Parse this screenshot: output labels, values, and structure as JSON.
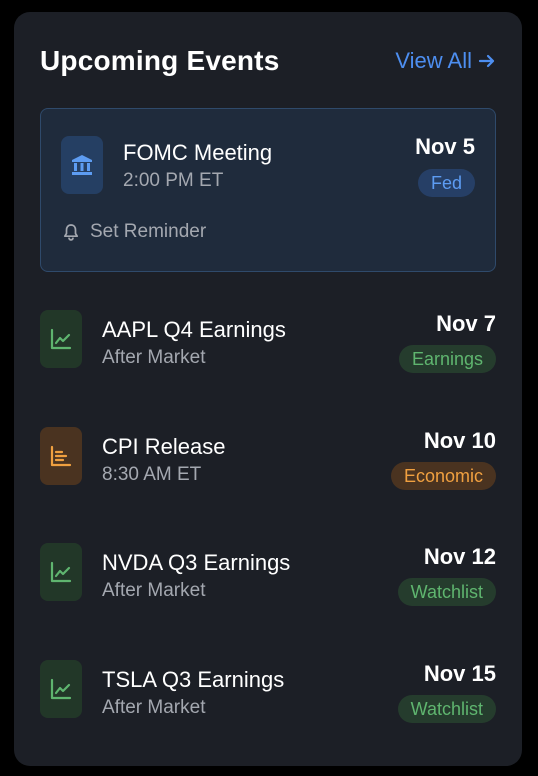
{
  "header": {
    "title": "Upcoming Events",
    "view_all_label": "View All"
  },
  "featured": {
    "name": "FOMC Meeting",
    "time": "2:00 PM ET",
    "date": "Nov 5",
    "tag": "Fed",
    "icon": "bank-icon",
    "reminder_label": "Set Reminder"
  },
  "events": [
    {
      "name": "AAPL Q4 Earnings",
      "time": "After Market",
      "date": "Nov 7",
      "tag": "Earnings",
      "icon": "chart-line-icon"
    },
    {
      "name": "CPI Release",
      "time": "8:30 AM ET",
      "date": "Nov 10",
      "tag": "Economic",
      "icon": "bar-chart-icon"
    },
    {
      "name": "NVDA Q3 Earnings",
      "time": "After Market",
      "date": "Nov 12",
      "tag": "Watchlist",
      "icon": "chart-line-icon"
    },
    {
      "name": "TSLA Q3 Earnings",
      "time": "After Market",
      "date": "Nov 15",
      "tag": "Watchlist",
      "icon": "chart-line-icon"
    }
  ],
  "colors": {
    "card_bg": "#1c1f26",
    "accent_blue": "#4d8ef0",
    "green": "#5fb56f",
    "orange": "#f0a040"
  }
}
